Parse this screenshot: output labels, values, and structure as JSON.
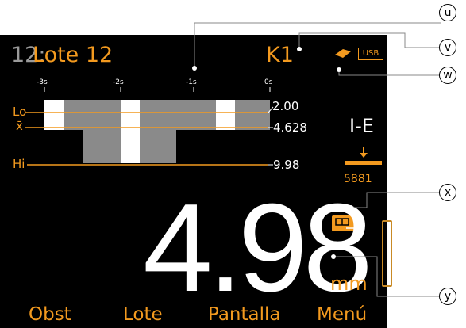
{
  "header": {
    "lot_number": "12:",
    "lot_name": "Lote 12",
    "probe": "K1",
    "usb_label": "USB",
    "probe_icon": "probe-icon"
  },
  "histogram": {
    "time_ticks": [
      "-3s",
      "-2s",
      "-1s",
      "0s"
    ],
    "lo_label": "Lo",
    "mean_label": "x̄",
    "hi_label": "Hi",
    "lo_value": "2.00",
    "mean_value": "4.628",
    "hi_value": "9.98"
  },
  "mode": {
    "label": "I-E",
    "count": "5881",
    "icon": "arrow-down-icon"
  },
  "reading": {
    "value": "4.98",
    "unit": "mm",
    "display_icon": "display-mode-icon"
  },
  "softkeys": [
    "Obst",
    "Lote",
    "Pantalla",
    "Menú"
  ],
  "callouts": [
    "u",
    "v",
    "w",
    "x",
    "y"
  ],
  "colors": {
    "accent": "#f39a1f",
    "bar": "#8a8a8a",
    "background": "#000000"
  }
}
